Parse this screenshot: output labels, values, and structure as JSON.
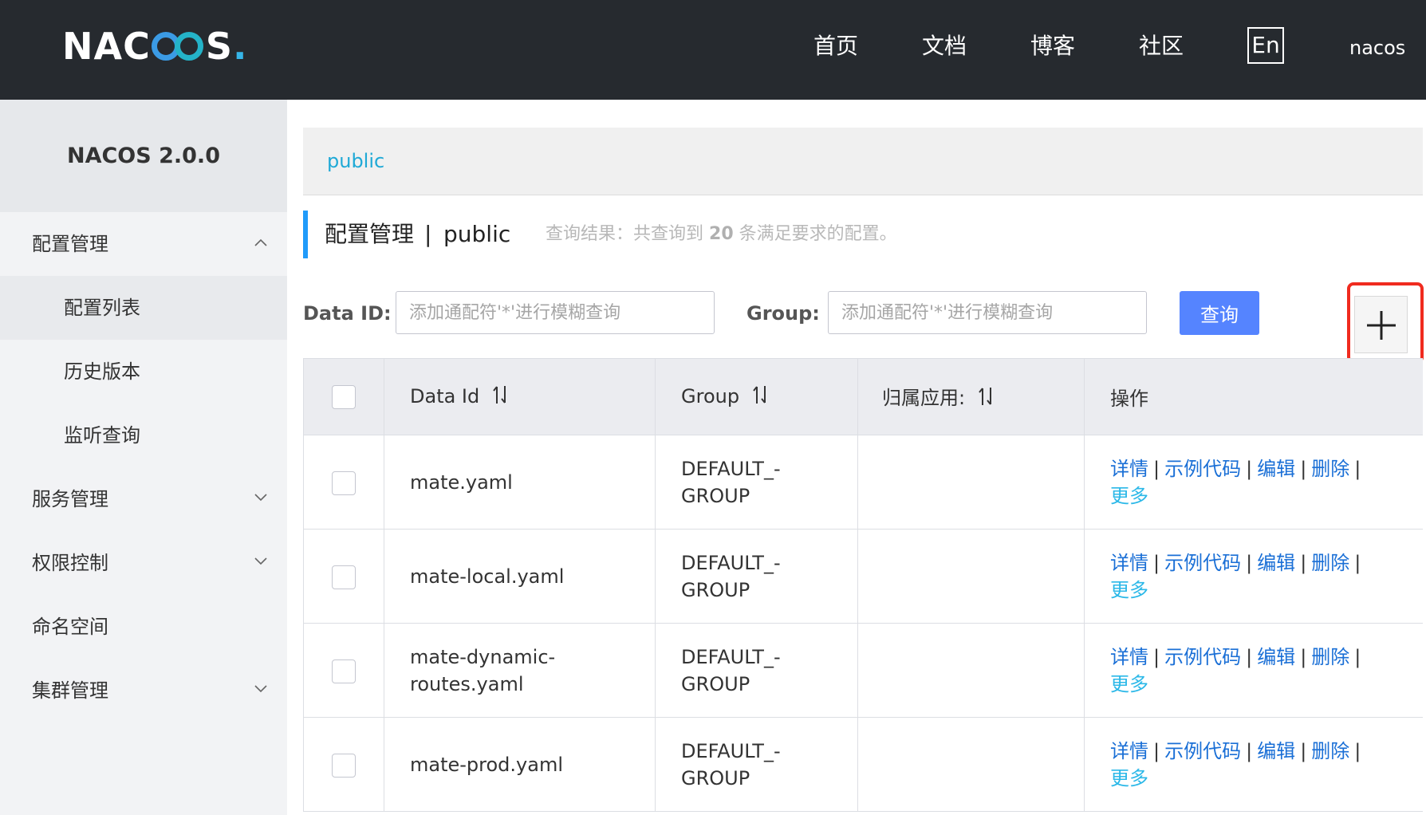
{
  "header": {
    "logo_text": "NACOS.",
    "nav": [
      "首页",
      "文档",
      "博客",
      "社区"
    ],
    "lang": "En",
    "user": "nacos"
  },
  "sidebar": {
    "version": "NACOS 2.0.0",
    "items": [
      {
        "label": "配置管理",
        "expanded": true
      },
      {
        "label": "配置列表",
        "active": true
      },
      {
        "label": "历史版本"
      },
      {
        "label": "监听查询"
      },
      {
        "label": "服务管理",
        "expanded": false
      },
      {
        "label": "权限控制",
        "expanded": false
      },
      {
        "label": "命名空间"
      },
      {
        "label": "集群管理",
        "expanded": false
      }
    ]
  },
  "namespace_bar": {
    "active": "public"
  },
  "page_title": {
    "title": "配置管理",
    "separator": "|",
    "namespace": "public",
    "result_prefix": "查询结果：共查询到",
    "result_count": "20",
    "result_suffix": "条满足要求的配置。"
  },
  "filters": {
    "data_id_label": "Data ID:",
    "data_id_placeholder": "添加通配符'*'进行模糊查询",
    "group_label": "Group:",
    "group_placeholder": "添加通配符'*'进行模糊查询",
    "query_label": "查询"
  },
  "table": {
    "columns": [
      "Data Id",
      "Group",
      "归属应用:",
      "操作"
    ],
    "actions": {
      "detail": "详情",
      "sample": "示例代码",
      "edit": "编辑",
      "delete": "删除",
      "more": "更多"
    },
    "rows": [
      {
        "data_id": "mate.yaml",
        "group": "DEFAULT_-\nGROUP",
        "app": ""
      },
      {
        "data_id": "mate-local.yaml",
        "group": "DEFAULT_-\nGROUP",
        "app": ""
      },
      {
        "data_id": "mate-dynamic-\nroutes.yaml",
        "group": "DEFAULT_-\nGROUP",
        "app": ""
      },
      {
        "data_id": "mate-prod.yaml",
        "group": "DEFAULT_-\nGROUP",
        "app": ""
      }
    ]
  },
  "colors": {
    "accent": "#209bfa",
    "query_button": "#5584ff",
    "link": "#1a6fd6",
    "annotation": "#f02b1f"
  }
}
